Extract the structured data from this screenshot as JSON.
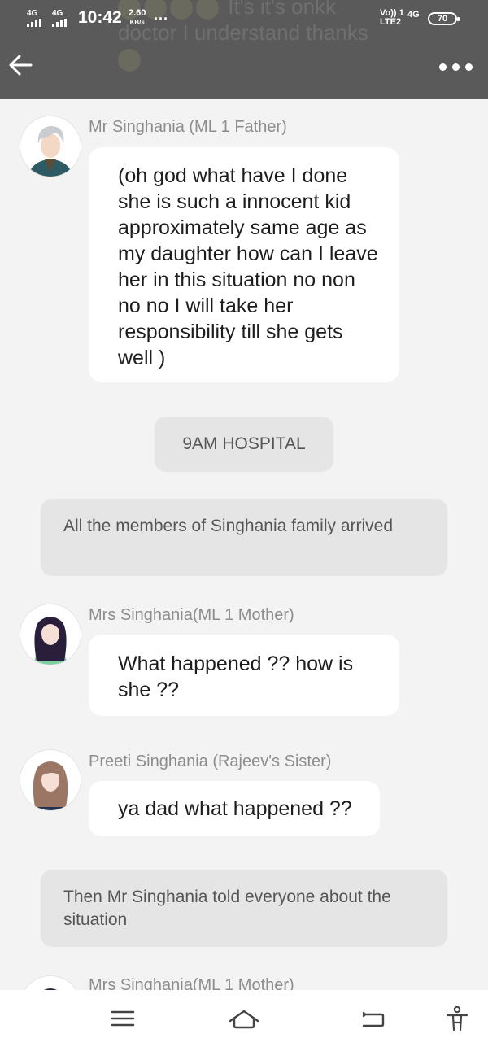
{
  "status": {
    "net1": "4G",
    "net2": "4G",
    "time": "10:42",
    "speed": "2.60",
    "speed_unit": "KB/s",
    "more": "...",
    "volte": "Vo)) 1",
    "lte": "LTE2",
    "net3": "4G",
    "battery": "70"
  },
  "header": {
    "back_icon": "arrow-left-icon",
    "more_icon": "more-dots-icon",
    "ghost_line1": "It's it's onkk",
    "ghost_line2": "doctor I understand thanks"
  },
  "messages": [
    {
      "sender": "Mr Singhania (ML 1 Father)",
      "text": "(oh god what have I done she is such a innocent kid approximately same age as my daughter how can I leave her in this situation no non no no I will take her responsibility till she gets well )"
    },
    {
      "scene": "9AM HOSPITAL"
    },
    {
      "narration": "All the members of Singhania family arrived"
    },
    {
      "sender": "Mrs Singhania(ML 1 Mother)",
      "text": "What happened ?? how is she ??"
    },
    {
      "sender": "Preeti Singhania (Rajeev's Sister)",
      "text": "ya dad what happened ??"
    },
    {
      "narration": "Then Mr Singhania told everyone about the situation"
    },
    {
      "sender": "Mrs Singhania(ML 1 Mother)"
    }
  ],
  "navbar": {
    "menu_icon": "menu-icon",
    "home_icon": "home-icon",
    "back_icon": "back-icon",
    "accessibility_icon": "accessibility-icon"
  },
  "colors": {
    "background": "#f3f3f3",
    "overlay": "#5a5a5a",
    "bubble": "#ffffff",
    "narration": "#e5e5e5",
    "sender": "#8d8d8d"
  }
}
